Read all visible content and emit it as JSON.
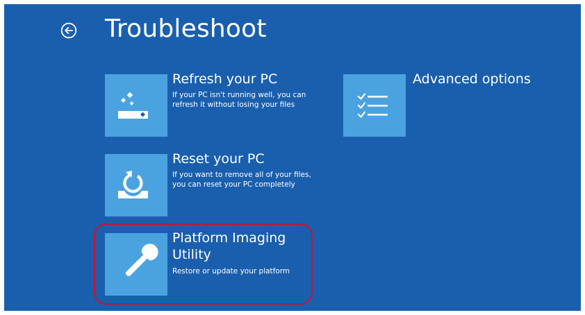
{
  "header": {
    "title": "Troubleshoot",
    "back_icon": "back-arrow-circle-icon"
  },
  "options": [
    {
      "title": "Refresh your PC",
      "description": "If your PC isn't running well, you can refresh it without losing your files",
      "icon": "refresh-pc-icon"
    },
    {
      "title": "Advanced options",
      "description": "",
      "icon": "checklist-icon"
    },
    {
      "title": "Reset your PC",
      "description": "If you want to remove all of your files, you can reset your PC completely",
      "icon": "reset-pc-icon"
    },
    {
      "title": "Platform Imaging Utility",
      "description": "Restore or update your platform",
      "icon": "wrench-icon",
      "highlighted": true
    }
  ],
  "colors": {
    "background": "#1a5fae",
    "tile": "#4aa3e0",
    "text": "#ffffff",
    "highlight": "#d0102a"
  }
}
